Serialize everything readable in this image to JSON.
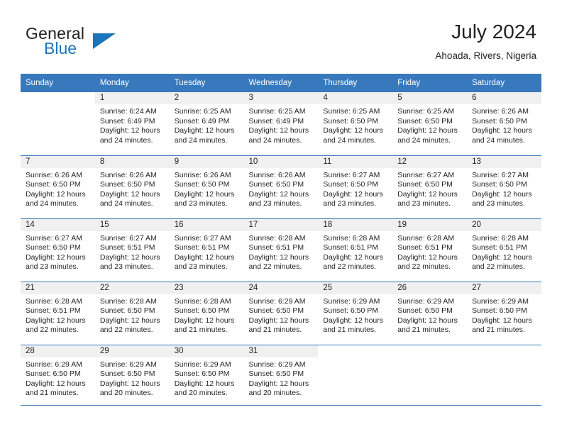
{
  "brand": {
    "name_top": "General",
    "name_bottom": "Blue",
    "accent_color": "#1b75bb",
    "triangle_icon": "brand-triangle-icon"
  },
  "header": {
    "title": "July 2024",
    "location": "Ahoada, Rivers, Nigeria"
  },
  "theme": {
    "header_row_bg": "#3878bc",
    "daynum_bg": "#f0f0f0",
    "grid_line": "#3878bc",
    "text": "#231f20"
  },
  "calendar": {
    "weekday_headers": [
      "Sunday",
      "Monday",
      "Tuesday",
      "Wednesday",
      "Thursday",
      "Friday",
      "Saturday"
    ],
    "weeks": [
      [
        {
          "day": "",
          "sunrise": "",
          "sunset": "",
          "daylight1": "",
          "daylight2": "",
          "empty": true
        },
        {
          "day": "1",
          "sunrise": "Sunrise: 6:24 AM",
          "sunset": "Sunset: 6:49 PM",
          "daylight1": "Daylight: 12 hours",
          "daylight2": "and 24 minutes.",
          "empty": false
        },
        {
          "day": "2",
          "sunrise": "Sunrise: 6:25 AM",
          "sunset": "Sunset: 6:49 PM",
          "daylight1": "Daylight: 12 hours",
          "daylight2": "and 24 minutes.",
          "empty": false
        },
        {
          "day": "3",
          "sunrise": "Sunrise: 6:25 AM",
          "sunset": "Sunset: 6:49 PM",
          "daylight1": "Daylight: 12 hours",
          "daylight2": "and 24 minutes.",
          "empty": false
        },
        {
          "day": "4",
          "sunrise": "Sunrise: 6:25 AM",
          "sunset": "Sunset: 6:50 PM",
          "daylight1": "Daylight: 12 hours",
          "daylight2": "and 24 minutes.",
          "empty": false
        },
        {
          "day": "5",
          "sunrise": "Sunrise: 6:25 AM",
          "sunset": "Sunset: 6:50 PM",
          "daylight1": "Daylight: 12 hours",
          "daylight2": "and 24 minutes.",
          "empty": false
        },
        {
          "day": "6",
          "sunrise": "Sunrise: 6:26 AM",
          "sunset": "Sunset: 6:50 PM",
          "daylight1": "Daylight: 12 hours",
          "daylight2": "and 24 minutes.",
          "empty": false
        }
      ],
      [
        {
          "day": "7",
          "sunrise": "Sunrise: 6:26 AM",
          "sunset": "Sunset: 6:50 PM",
          "daylight1": "Daylight: 12 hours",
          "daylight2": "and 24 minutes.",
          "empty": false
        },
        {
          "day": "8",
          "sunrise": "Sunrise: 6:26 AM",
          "sunset": "Sunset: 6:50 PM",
          "daylight1": "Daylight: 12 hours",
          "daylight2": "and 24 minutes.",
          "empty": false
        },
        {
          "day": "9",
          "sunrise": "Sunrise: 6:26 AM",
          "sunset": "Sunset: 6:50 PM",
          "daylight1": "Daylight: 12 hours",
          "daylight2": "and 23 minutes.",
          "empty": false
        },
        {
          "day": "10",
          "sunrise": "Sunrise: 6:26 AM",
          "sunset": "Sunset: 6:50 PM",
          "daylight1": "Daylight: 12 hours",
          "daylight2": "and 23 minutes.",
          "empty": false
        },
        {
          "day": "11",
          "sunrise": "Sunrise: 6:27 AM",
          "sunset": "Sunset: 6:50 PM",
          "daylight1": "Daylight: 12 hours",
          "daylight2": "and 23 minutes.",
          "empty": false
        },
        {
          "day": "12",
          "sunrise": "Sunrise: 6:27 AM",
          "sunset": "Sunset: 6:50 PM",
          "daylight1": "Daylight: 12 hours",
          "daylight2": "and 23 minutes.",
          "empty": false
        },
        {
          "day": "13",
          "sunrise": "Sunrise: 6:27 AM",
          "sunset": "Sunset: 6:50 PM",
          "daylight1": "Daylight: 12 hours",
          "daylight2": "and 23 minutes.",
          "empty": false
        }
      ],
      [
        {
          "day": "14",
          "sunrise": "Sunrise: 6:27 AM",
          "sunset": "Sunset: 6:50 PM",
          "daylight1": "Daylight: 12 hours",
          "daylight2": "and 23 minutes.",
          "empty": false
        },
        {
          "day": "15",
          "sunrise": "Sunrise: 6:27 AM",
          "sunset": "Sunset: 6:51 PM",
          "daylight1": "Daylight: 12 hours",
          "daylight2": "and 23 minutes.",
          "empty": false
        },
        {
          "day": "16",
          "sunrise": "Sunrise: 6:27 AM",
          "sunset": "Sunset: 6:51 PM",
          "daylight1": "Daylight: 12 hours",
          "daylight2": "and 23 minutes.",
          "empty": false
        },
        {
          "day": "17",
          "sunrise": "Sunrise: 6:28 AM",
          "sunset": "Sunset: 6:51 PM",
          "daylight1": "Daylight: 12 hours",
          "daylight2": "and 22 minutes.",
          "empty": false
        },
        {
          "day": "18",
          "sunrise": "Sunrise: 6:28 AM",
          "sunset": "Sunset: 6:51 PM",
          "daylight1": "Daylight: 12 hours",
          "daylight2": "and 22 minutes.",
          "empty": false
        },
        {
          "day": "19",
          "sunrise": "Sunrise: 6:28 AM",
          "sunset": "Sunset: 6:51 PM",
          "daylight1": "Daylight: 12 hours",
          "daylight2": "and 22 minutes.",
          "empty": false
        },
        {
          "day": "20",
          "sunrise": "Sunrise: 6:28 AM",
          "sunset": "Sunset: 6:51 PM",
          "daylight1": "Daylight: 12 hours",
          "daylight2": "and 22 minutes.",
          "empty": false
        }
      ],
      [
        {
          "day": "21",
          "sunrise": "Sunrise: 6:28 AM",
          "sunset": "Sunset: 6:51 PM",
          "daylight1": "Daylight: 12 hours",
          "daylight2": "and 22 minutes.",
          "empty": false
        },
        {
          "day": "22",
          "sunrise": "Sunrise: 6:28 AM",
          "sunset": "Sunset: 6:50 PM",
          "daylight1": "Daylight: 12 hours",
          "daylight2": "and 22 minutes.",
          "empty": false
        },
        {
          "day": "23",
          "sunrise": "Sunrise: 6:28 AM",
          "sunset": "Sunset: 6:50 PM",
          "daylight1": "Daylight: 12 hours",
          "daylight2": "and 21 minutes.",
          "empty": false
        },
        {
          "day": "24",
          "sunrise": "Sunrise: 6:29 AM",
          "sunset": "Sunset: 6:50 PM",
          "daylight1": "Daylight: 12 hours",
          "daylight2": "and 21 minutes.",
          "empty": false
        },
        {
          "day": "25",
          "sunrise": "Sunrise: 6:29 AM",
          "sunset": "Sunset: 6:50 PM",
          "daylight1": "Daylight: 12 hours",
          "daylight2": "and 21 minutes.",
          "empty": false
        },
        {
          "day": "26",
          "sunrise": "Sunrise: 6:29 AM",
          "sunset": "Sunset: 6:50 PM",
          "daylight1": "Daylight: 12 hours",
          "daylight2": "and 21 minutes.",
          "empty": false
        },
        {
          "day": "27",
          "sunrise": "Sunrise: 6:29 AM",
          "sunset": "Sunset: 6:50 PM",
          "daylight1": "Daylight: 12 hours",
          "daylight2": "and 21 minutes.",
          "empty": false
        }
      ],
      [
        {
          "day": "28",
          "sunrise": "Sunrise: 6:29 AM",
          "sunset": "Sunset: 6:50 PM",
          "daylight1": "Daylight: 12 hours",
          "daylight2": "and 21 minutes.",
          "empty": false
        },
        {
          "day": "29",
          "sunrise": "Sunrise: 6:29 AM",
          "sunset": "Sunset: 6:50 PM",
          "daylight1": "Daylight: 12 hours",
          "daylight2": "and 20 minutes.",
          "empty": false
        },
        {
          "day": "30",
          "sunrise": "Sunrise: 6:29 AM",
          "sunset": "Sunset: 6:50 PM",
          "daylight1": "Daylight: 12 hours",
          "daylight2": "and 20 minutes.",
          "empty": false
        },
        {
          "day": "31",
          "sunrise": "Sunrise: 6:29 AM",
          "sunset": "Sunset: 6:50 PM",
          "daylight1": "Daylight: 12 hours",
          "daylight2": "and 20 minutes.",
          "empty": false
        },
        {
          "day": "",
          "sunrise": "",
          "sunset": "",
          "daylight1": "",
          "daylight2": "",
          "empty": true
        },
        {
          "day": "",
          "sunrise": "",
          "sunset": "",
          "daylight1": "",
          "daylight2": "",
          "empty": true
        },
        {
          "day": "",
          "sunrise": "",
          "sunset": "",
          "daylight1": "",
          "daylight2": "",
          "empty": true
        }
      ]
    ]
  }
}
